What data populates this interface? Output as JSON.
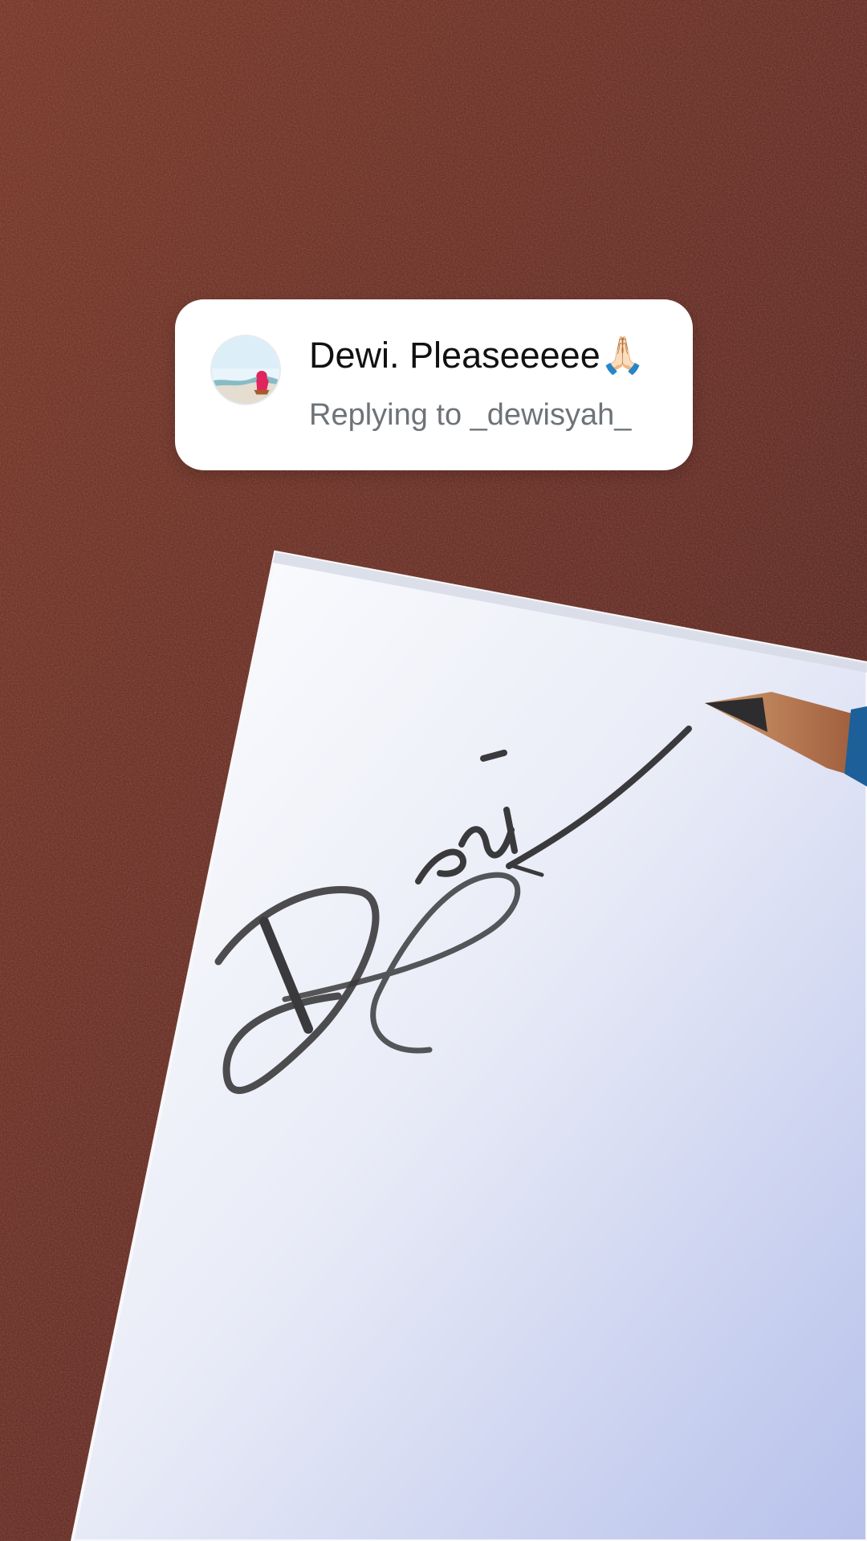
{
  "comment": {
    "text": "Dewi. Pleaseeeee🙏🏻",
    "reply_label": "Replying to _dewisyah_"
  },
  "signature_text": "Dewi",
  "colors": {
    "leather": "#6c2c21",
    "paper": "#f2f4fb",
    "card": "#ffffff",
    "reply_gray": "#6e7378"
  },
  "icons": {
    "avatar": "profile-photo"
  }
}
